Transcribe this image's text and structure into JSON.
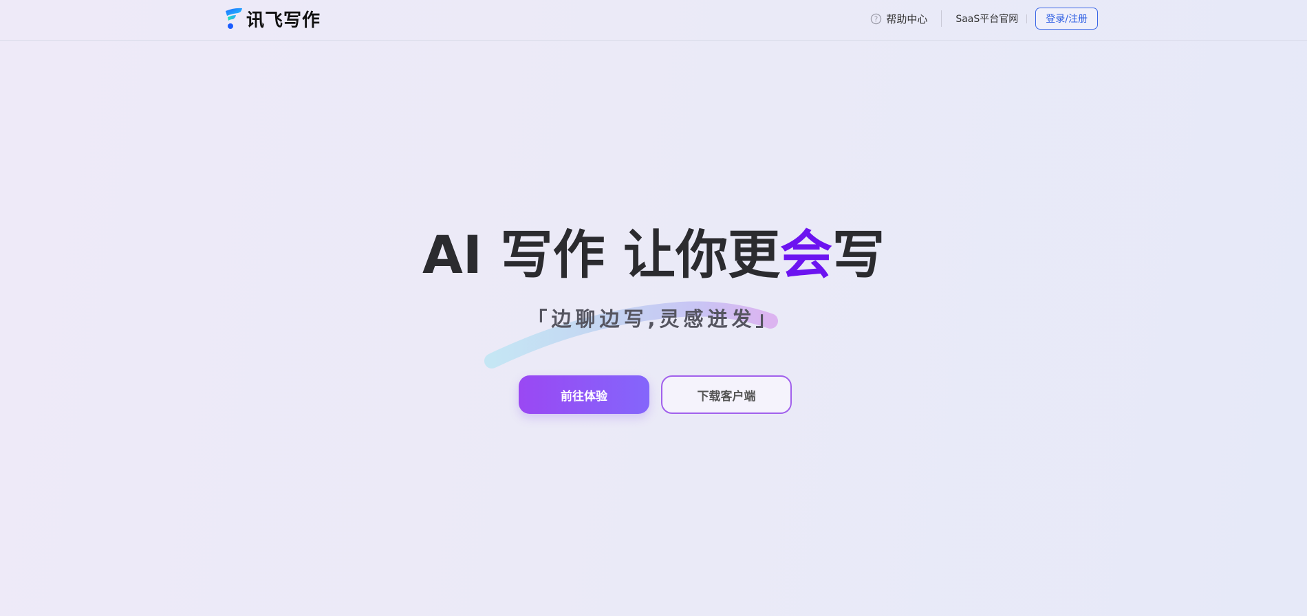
{
  "header": {
    "logo_text": "讯飞写作",
    "logo_icon": "iflytek-brand-icon",
    "nav": {
      "help_icon": "question-circle-icon",
      "help_label": "帮助中心",
      "saas_label": "SaaS平台官网",
      "login_label": "登录/注册"
    }
  },
  "hero": {
    "title_main": "AI 写作 让你更",
    "title_accent": "会",
    "title_end": "写",
    "subtitle": "「边聊边写,灵感迸发」",
    "primary_button": "前往体验",
    "secondary_button": "下载客户端"
  },
  "colors": {
    "accent_purple": "#6c14f0",
    "login_blue": "#2f5fe3",
    "button_gradient_start": "#9a48f3",
    "button_gradient_end": "#8466fb"
  }
}
